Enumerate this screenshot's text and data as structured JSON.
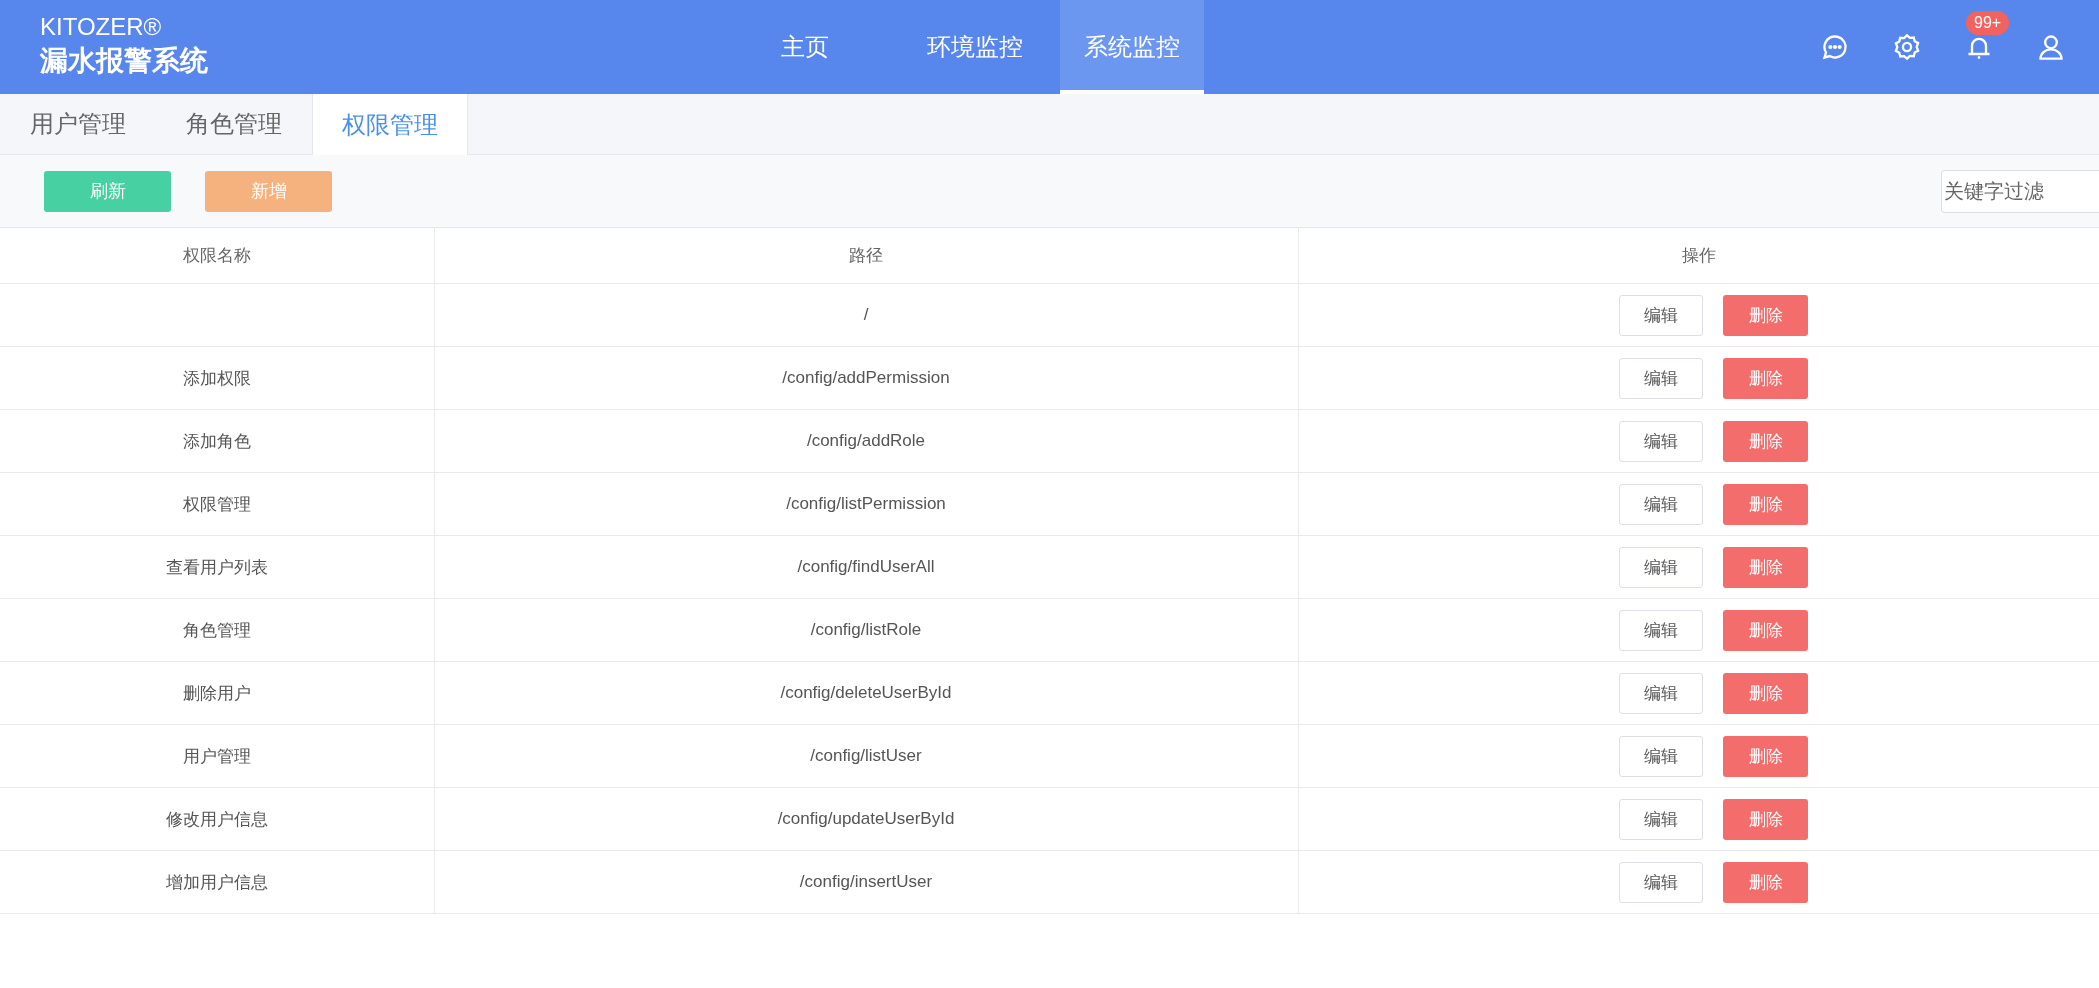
{
  "brand": {
    "name": "KITOZER®",
    "title": "漏水报警系统"
  },
  "nav": [
    {
      "label": "主页",
      "selected": false
    },
    {
      "label": "环境监控",
      "selected": false
    },
    {
      "label": "系统监控",
      "selected": true
    }
  ],
  "header_icons": {
    "notification_badge": "99+"
  },
  "tabs": [
    {
      "label": "用户管理",
      "selected": false
    },
    {
      "label": "角色管理",
      "selected": false
    },
    {
      "label": "权限管理",
      "selected": true
    }
  ],
  "toolbar": {
    "buttons": [
      {
        "label": "刷新",
        "kind": "refresh"
      },
      {
        "label": "新增",
        "kind": "add"
      }
    ],
    "search": {
      "placeholder": "关键字过滤"
    }
  },
  "table": {
    "columns": [
      "权限名称",
      "路径",
      "操作"
    ],
    "rows": [
      {
        "name": "",
        "path": "/",
        "actions": [
          "编辑",
          "删除"
        ]
      },
      {
        "name": "添加权限",
        "path": "/config/addPermission",
        "actions": [
          "编辑",
          "删除"
        ]
      },
      {
        "name": "添加角色",
        "path": "/config/addRole",
        "actions": [
          "编辑",
          "删除"
        ]
      },
      {
        "name": "权限管理",
        "path": "/config/listPermission",
        "actions": [
          "编辑",
          "删除"
        ]
      },
      {
        "name": "查看用户列表",
        "path": "/config/findUserAll",
        "actions": [
          "编辑",
          "删除"
        ]
      },
      {
        "name": "角色管理",
        "path": "/config/listRole",
        "actions": [
          "编辑",
          "删除"
        ]
      },
      {
        "name": "删除用户",
        "path": "/config/deleteUserById",
        "actions": [
          "编辑",
          "删除"
        ]
      },
      {
        "name": "用户管理",
        "path": "/config/listUser",
        "actions": [
          "编辑",
          "删除"
        ]
      },
      {
        "name": "修改用户信息",
        "path": "/config/updateUserById",
        "actions": [
          "编辑",
          "删除"
        ]
      },
      {
        "name": "增加用户信息",
        "path": "/config/insertUser",
        "actions": [
          "编辑",
          "删除"
        ]
      }
    ]
  }
}
